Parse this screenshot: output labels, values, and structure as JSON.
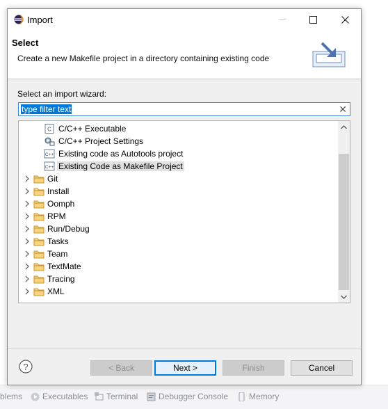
{
  "dialog": {
    "title": "Import",
    "header_title": "Select",
    "header_description": "Create a new Makefile project in a directory containing existing code"
  },
  "wizard": {
    "label": "Select an import wizard:",
    "filter_value": "type filter text"
  },
  "tree": {
    "items": [
      {
        "label": "C/C++ Executable",
        "icon": "cpp-executable-icon",
        "level": 1
      },
      {
        "label": "C/C++ Project Settings",
        "icon": "project-settings-icon",
        "level": 1
      },
      {
        "label": "Existing code as Autotools project",
        "icon": "cpp-file-icon",
        "level": 1
      },
      {
        "label": "Existing Code as Makefile Project",
        "icon": "cpp-file-icon",
        "level": 1,
        "selected": true
      },
      {
        "label": "Git",
        "icon": "folder-icon",
        "level": 0
      },
      {
        "label": "Install",
        "icon": "folder-icon",
        "level": 0
      },
      {
        "label": "Oomph",
        "icon": "folder-icon",
        "level": 0
      },
      {
        "label": "RPM",
        "icon": "folder-icon",
        "level": 0
      },
      {
        "label": "Run/Debug",
        "icon": "folder-icon",
        "level": 0
      },
      {
        "label": "Tasks",
        "icon": "folder-icon",
        "level": 0
      },
      {
        "label": "Team",
        "icon": "folder-icon",
        "level": 0
      },
      {
        "label": "TextMate",
        "icon": "folder-icon",
        "level": 0
      },
      {
        "label": "Tracing",
        "icon": "folder-icon",
        "level": 0
      },
      {
        "label": "XML",
        "icon": "folder-icon",
        "level": 0
      }
    ]
  },
  "buttons": {
    "back": "< Back",
    "next": "Next >",
    "finish": "Finish",
    "cancel": "Cancel"
  },
  "background_tabs": [
    {
      "label": "blems",
      "icon": "problems-icon"
    },
    {
      "label": "Executables",
      "icon": "executables-icon"
    },
    {
      "label": "Terminal",
      "icon": "terminal-icon"
    },
    {
      "label": "Debugger Console",
      "icon": "debugger-console-icon"
    },
    {
      "label": "Memory",
      "icon": "memory-icon"
    }
  ],
  "colors": {
    "accent": "#0078d7",
    "folder": "#dcaa3c",
    "dialog_bg": "#f0f0f0"
  }
}
